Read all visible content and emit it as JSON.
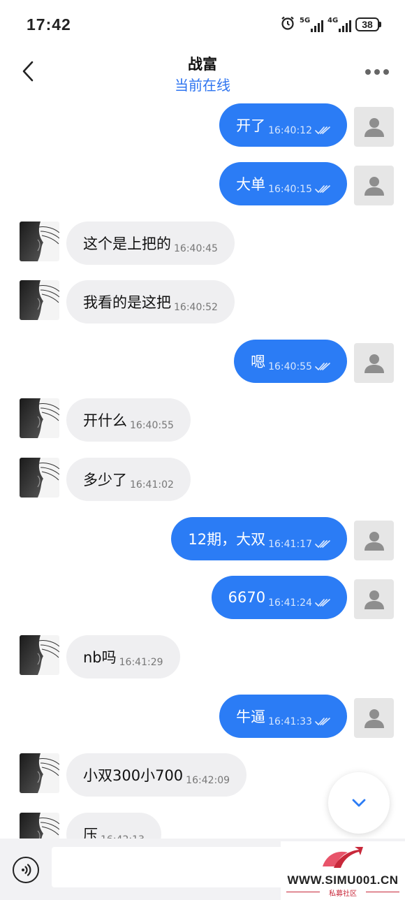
{
  "status_bar": {
    "time": "17:42",
    "network_1": "5G",
    "network_2": "4G",
    "battery": "38",
    "icons": [
      "alarm-icon",
      "signal-icon",
      "signal-icon",
      "battery-icon"
    ]
  },
  "header": {
    "title": "战富",
    "subtitle": "当前在线",
    "icons": [
      "back-arrow-icon",
      "more-icon"
    ]
  },
  "messages": [
    {
      "direction": "out",
      "text": "开了",
      "time": "16:40:12",
      "status": "read"
    },
    {
      "direction": "out",
      "text": "大单",
      "time": "16:40:15",
      "status": "read"
    },
    {
      "direction": "in",
      "text": "这个是上把的",
      "time": "16:40:45"
    },
    {
      "direction": "in",
      "text": "我看的是这把",
      "time": "16:40:52"
    },
    {
      "direction": "out",
      "text": "嗯",
      "time": "16:40:55",
      "status": "read"
    },
    {
      "direction": "in",
      "text": "开什么",
      "time": "16:40:55"
    },
    {
      "direction": "in",
      "text": "多少了",
      "time": "16:41:02"
    },
    {
      "direction": "out",
      "text": "12期，大双",
      "time": "16:41:17",
      "status": "read"
    },
    {
      "direction": "out",
      "text": "6670",
      "time": "16:41:24",
      "status": "read"
    },
    {
      "direction": "in",
      "text": "nb吗",
      "time": "16:41:29"
    },
    {
      "direction": "out",
      "text": "牛逼",
      "time": "16:41:33",
      "status": "read"
    },
    {
      "direction": "in",
      "text": "小双300小700",
      "time": "16:42:09"
    },
    {
      "direction": "in",
      "text": "压",
      "time": "16:42:13"
    }
  ],
  "composer": {
    "value": "",
    "icons": [
      "voice-icon"
    ]
  },
  "scroll_button": {
    "icon": "chevron-down-icon"
  },
  "watermark": {
    "text": "WWW.SIMU001.CN",
    "sub": "私募社区"
  },
  "colors": {
    "accent": "#2b7cf5",
    "online": "#2e74f0",
    "incoming_bubble": "#efeff1",
    "self_avatar_bg": "#e6e6e6"
  }
}
